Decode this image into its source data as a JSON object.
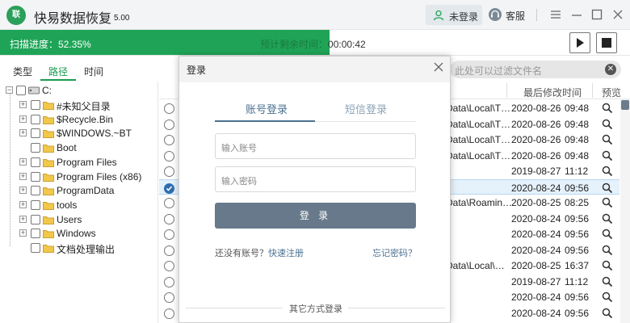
{
  "app": {
    "logo_text": "联",
    "title": "快易数据恢复",
    "version": "5.00"
  },
  "header": {
    "login_label": "未登录",
    "service_label": "客服"
  },
  "scan": {
    "progress_text": "扫描进度：52.35%",
    "progress_value": 0.5235,
    "remaining_label": "预计剩余时间：",
    "remaining_value": "00:00:42"
  },
  "tabs": {
    "type": "类型",
    "path": "路径",
    "time": "时间",
    "active": "路径"
  },
  "tree": {
    "root": "C:",
    "items": [
      "#未知父目录",
      "$Recycle.Bin",
      "$WINDOWS.~BT",
      "Boot",
      "Program Files",
      "Program Files (x86)",
      "ProgramData",
      "tools",
      "Users",
      "Windows",
      "文档处理输出"
    ]
  },
  "filter": {
    "placeholder": "此处可以过滤文件名"
  },
  "list": {
    "col_modified": "最后修改时间",
    "col_preview": "预览",
    "rows": [
      {
        "path": "Data\\Local\\T…",
        "date": "2020-08-26",
        "time": "09:48",
        "checked": false
      },
      {
        "path": "Data\\Local\\T…",
        "date": "2020-08-26",
        "time": "09:48",
        "checked": false
      },
      {
        "path": "Data\\Local\\T…",
        "date": "2020-08-26",
        "time": "09:48",
        "checked": false
      },
      {
        "path": "Data\\Local\\T…",
        "date": "2020-08-26",
        "time": "09:48",
        "checked": false
      },
      {
        "path": "",
        "date": "2019-08-27",
        "time": "11:12",
        "checked": false
      },
      {
        "path": "",
        "date": "2020-08-24",
        "time": "09:56",
        "checked": true
      },
      {
        "path": "Data\\Roamin…",
        "date": "2020-08-25",
        "time": "08:25",
        "checked": false
      },
      {
        "path": "",
        "date": "2020-08-24",
        "time": "09:56",
        "checked": false
      },
      {
        "path": "",
        "date": "2020-08-24",
        "time": "09:56",
        "checked": false
      },
      {
        "path": "",
        "date": "2020-08-24",
        "time": "09:56",
        "checked": false
      },
      {
        "path": "Data\\Local\\…",
        "date": "2020-08-25",
        "time": "16:37",
        "checked": false
      },
      {
        "path": "",
        "date": "2019-08-27",
        "time": "11:12",
        "checked": false
      },
      {
        "path": "",
        "date": "2020-08-24",
        "time": "09:56",
        "checked": false
      },
      {
        "path": "",
        "date": "2020-08-24",
        "time": "09:56",
        "checked": false
      }
    ]
  },
  "login": {
    "title": "登录",
    "tab_account": "账号登录",
    "tab_sms": "短信登录",
    "account_placeholder": "输入账号",
    "password_placeholder": "输入密码",
    "submit_label": "登 录",
    "no_account_text": "还没有账号？",
    "register_link": "快速注册",
    "forgot_link": "忘记密码？",
    "other_methods": "其它方式登录"
  },
  "colors": {
    "accent_green": "#1fa457",
    "login_button": "#67798a",
    "link_blue": "#4c7192"
  }
}
